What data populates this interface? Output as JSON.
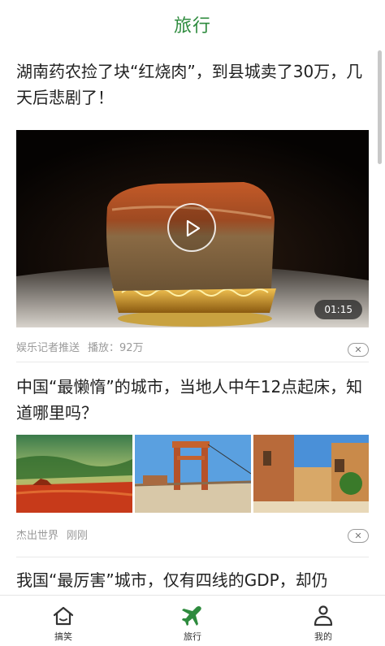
{
  "header": {
    "title": "旅行"
  },
  "articles": [
    {
      "headline": "湖南药农捡了块“红烧肉”，到县城卖了30万，几天后悲剧了！",
      "video_duration": "01:15",
      "source": "娱乐记者推送",
      "plays": "播放：92万"
    },
    {
      "headline": "中国“最懒惰”的城市，当地人中午12点起床，知道哪里吗？",
      "source": "杰出世界",
      "time": "刚刚"
    },
    {
      "headline": "我国“最厉害”城市，仅有四线的GDP，却仍"
    }
  ],
  "tabbar": {
    "items": [
      {
        "label": "搞笑",
        "icon": "home-icon"
      },
      {
        "label": "旅行",
        "icon": "airplane-icon",
        "active": true
      },
      {
        "label": "我的",
        "icon": "user-icon"
      }
    ]
  },
  "colors": {
    "accent": "#2e8b3e",
    "meta_text": "#9a9a9a"
  }
}
